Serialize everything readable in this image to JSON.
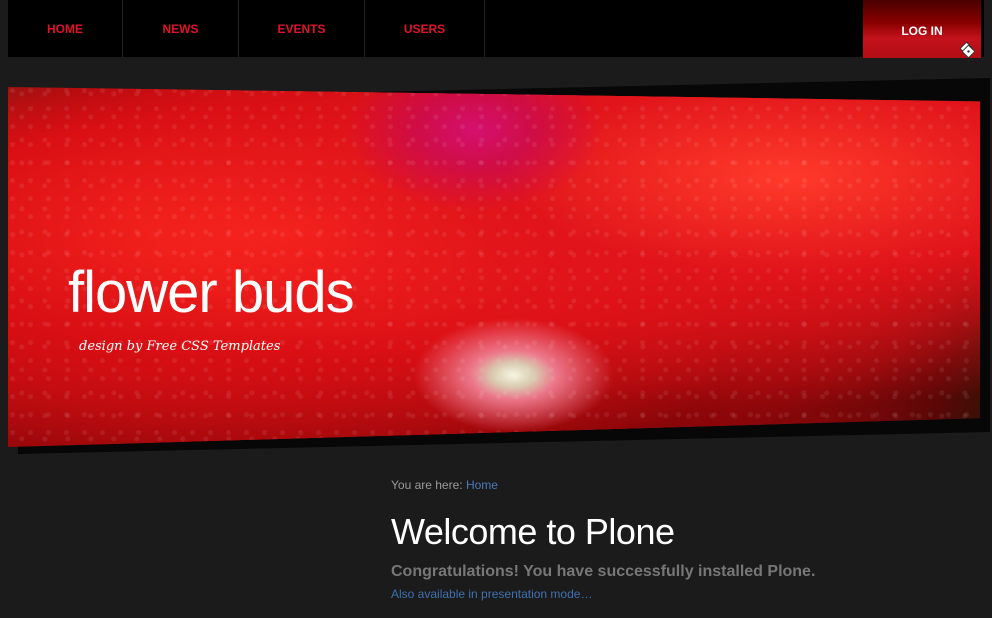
{
  "nav": {
    "items": [
      {
        "label": "HOME"
      },
      {
        "label": "NEWS"
      },
      {
        "label": "EVENTS"
      },
      {
        "label": "USERS"
      }
    ],
    "login_label": "LOG IN",
    "login_icon": "login-key-icon"
  },
  "banner": {
    "title": "flower buds",
    "subtitle": "design by Free CSS Templates"
  },
  "breadcrumb": {
    "prefix": "You are here:",
    "home": "Home"
  },
  "main": {
    "title": "Welcome to Plone",
    "description": "Congratulations! You have successfully installed Plone.",
    "presentation_link": "Also available in presentation mode…"
  },
  "colors": {
    "background": "#1b1b1b",
    "nav_text": "#e0132a",
    "login_bg": "#c4121c",
    "link": "#3f71b0"
  }
}
